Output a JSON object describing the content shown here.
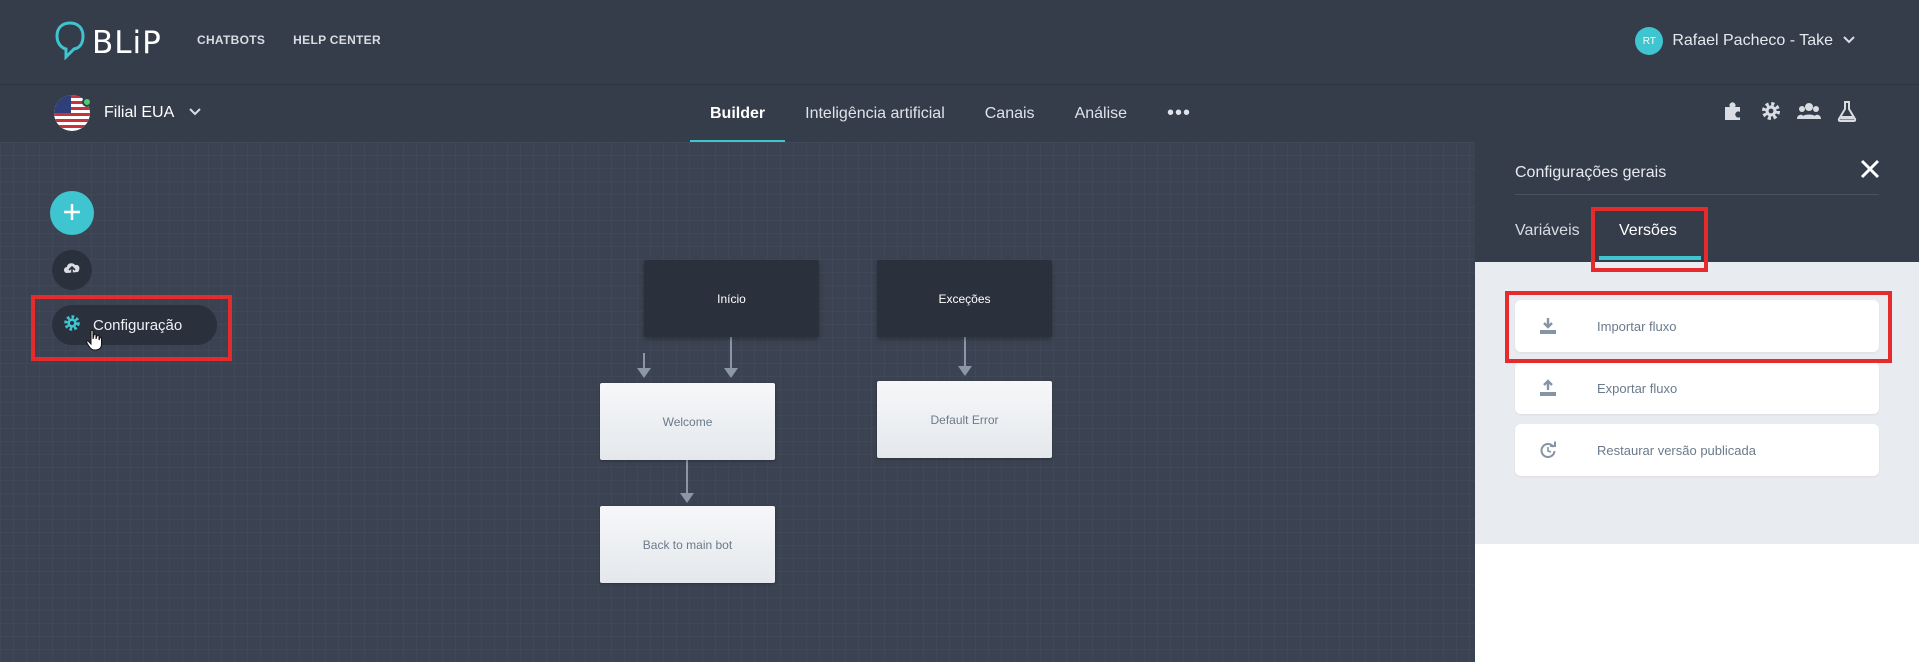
{
  "app": {
    "logo_text": "BLiP"
  },
  "topnav": {
    "items": [
      "CHATBOTS",
      "HELP CENTER"
    ]
  },
  "user": {
    "initials": "RT",
    "name": "Rafael Pacheco - Take"
  },
  "bot": {
    "name": "Filial EUA"
  },
  "tabs": [
    {
      "label": "Builder",
      "active": true
    },
    {
      "label": "Inteligência artificial"
    },
    {
      "label": "Canais"
    },
    {
      "label": "Análise"
    },
    {
      "label": "•••"
    }
  ],
  "toolbar_icons": [
    "puzzle-icon",
    "gear-icon",
    "users-icon",
    "flask-icon"
  ],
  "builder": {
    "config_label": "Configuração",
    "blocks": {
      "inicio": "Início",
      "excecoes": "Exceções",
      "welcome": "Welcome",
      "default_error": "Default Error",
      "back_to_main": "Back to main bot"
    }
  },
  "panel": {
    "title": "Configurações gerais",
    "tabs": {
      "variaveis": "Variáveis",
      "versoes": "Versões"
    },
    "actions": {
      "importar": "Importar fluxo",
      "exportar": "Exportar fluxo",
      "restaurar": "Restaurar versão publicada"
    }
  },
  "colors": {
    "accent": "#3ec5d0",
    "highlight": "#e52b2b",
    "background": "#3b4352"
  }
}
